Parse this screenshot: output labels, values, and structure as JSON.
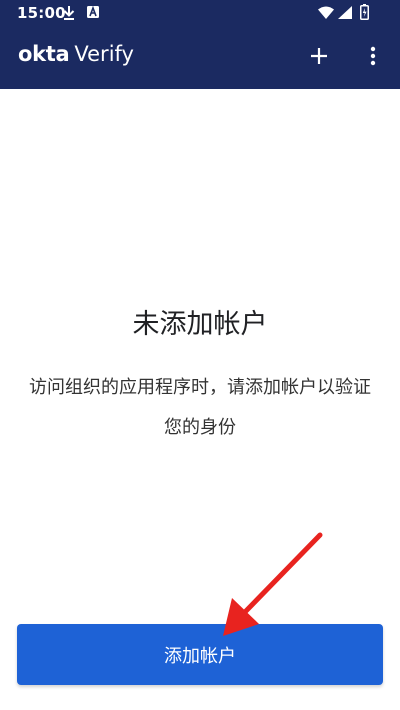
{
  "status_bar": {
    "time": "15:00",
    "icons": [
      "download-icon",
      "notification-a-icon",
      "wifi-icon",
      "signal-icon",
      "battery-icon"
    ]
  },
  "app_bar": {
    "brand_bold": "okta",
    "brand_regular": "Verify",
    "actions": [
      "add-icon",
      "more-vert-icon"
    ]
  },
  "empty_state": {
    "title": "未添加帐户",
    "description": "访问组织的应用程序时，请添加帐户以验证您的身份"
  },
  "primary_button": {
    "label": "添加帐户"
  },
  "colors": {
    "header": "#1b2a61",
    "button": "#1e62d6",
    "annotation_arrow": "#e8231f"
  }
}
